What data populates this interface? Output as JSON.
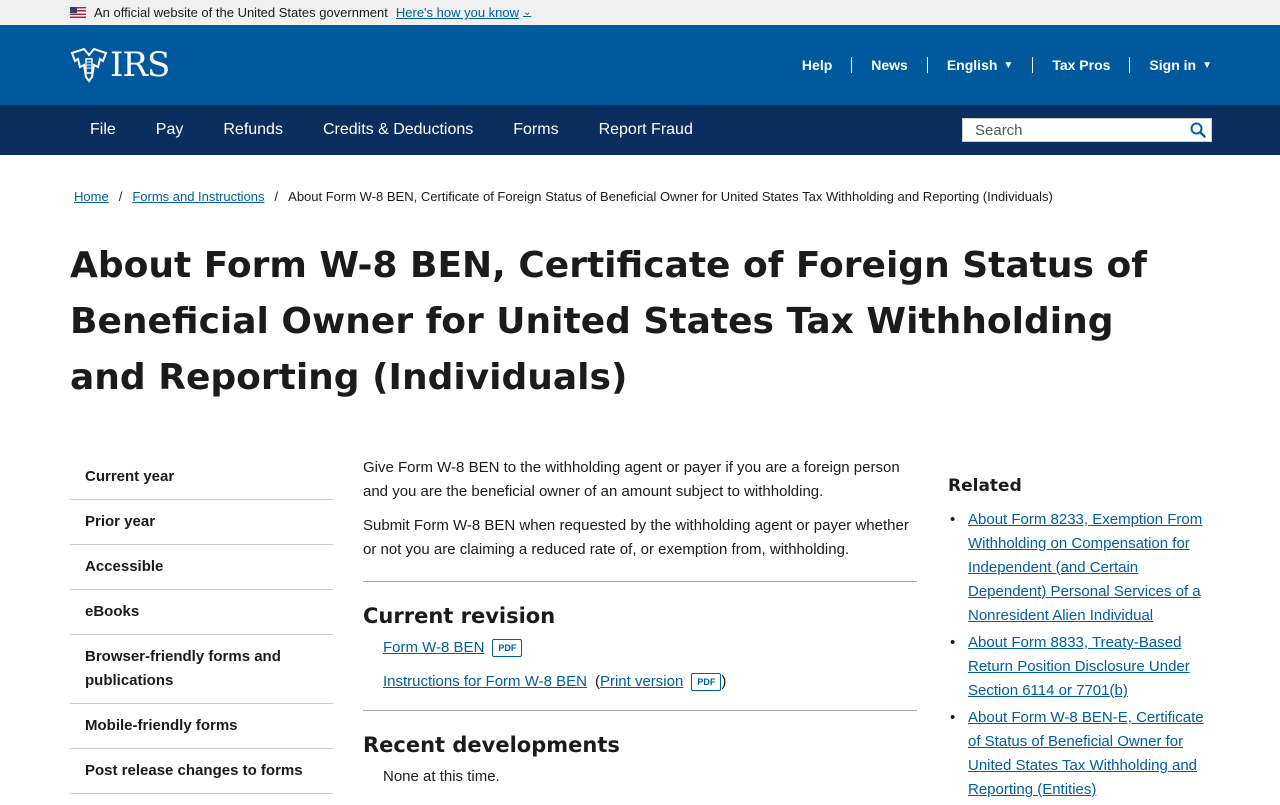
{
  "gov_banner": {
    "text": "An official website of the United States government",
    "link": "Here's how you know"
  },
  "header": {
    "logo": "IRS",
    "util_nav": [
      {
        "label": "Help"
      },
      {
        "label": "News"
      },
      {
        "label": "English"
      },
      {
        "label": "Tax Pros"
      },
      {
        "label": "Sign in"
      }
    ]
  },
  "main_nav": {
    "items": [
      "File",
      "Pay",
      "Refunds",
      "Credits & Deductions",
      "Forms",
      "Report Fraud"
    ],
    "search_placeholder": "Search"
  },
  "breadcrumb": {
    "home": "Home",
    "forms": "Forms and Instructions",
    "current": "About Form W-8 BEN, Certificate of Foreign Status of Beneficial Owner for United States Tax Withholding and Reporting (Individuals)"
  },
  "page_title": "About Form W-8 BEN, Certificate of Foreign Status of Beneficial Owner for United States Tax Withholding and Reporting (Individuals)",
  "sidebar": {
    "items": [
      "Current year",
      "Prior year",
      "Accessible",
      "eBooks",
      "Browser-friendly forms and publications",
      "Mobile-friendly forms",
      "Post release changes to forms"
    ]
  },
  "main": {
    "para1": "Give Form W-8 BEN to the withholding agent or payer if you are a foreign person and you are the beneficial owner of an amount subject to withholding.",
    "para2": "Submit Form W-8 BEN when requested by the withholding agent or payer whether or not you are claiming a reduced rate of, or exemption from, withholding.",
    "current_revision_heading": "Current revision",
    "form_link": "Form W-8 BEN",
    "pdf_label": "PDF",
    "instructions_link": "Instructions for Form W-8 BEN",
    "print_version": "Print version",
    "open_paren": "(",
    "close_paren": ")",
    "recent_heading": "Recent developments",
    "none_text": "None at this time."
  },
  "related": {
    "heading": "Related",
    "items": [
      "About Form 8233, Exemption From Withholding on Compensation for Independent (and Certain Dependent) Personal Services of a Nonresident Alien Individual",
      "About Form 8833, Treaty-Based Return Position Disclosure Under Section 6114 or 7701(b)",
      "About Form W-8 BEN-E, Certificate of Status of Beneficial Owner for United States Tax Withholding and Reporting (Entities)"
    ]
  },
  "colors": {
    "header_blue": "#00599c",
    "nav_navy": "#0b2e5e",
    "link_blue": "#005ea2"
  }
}
